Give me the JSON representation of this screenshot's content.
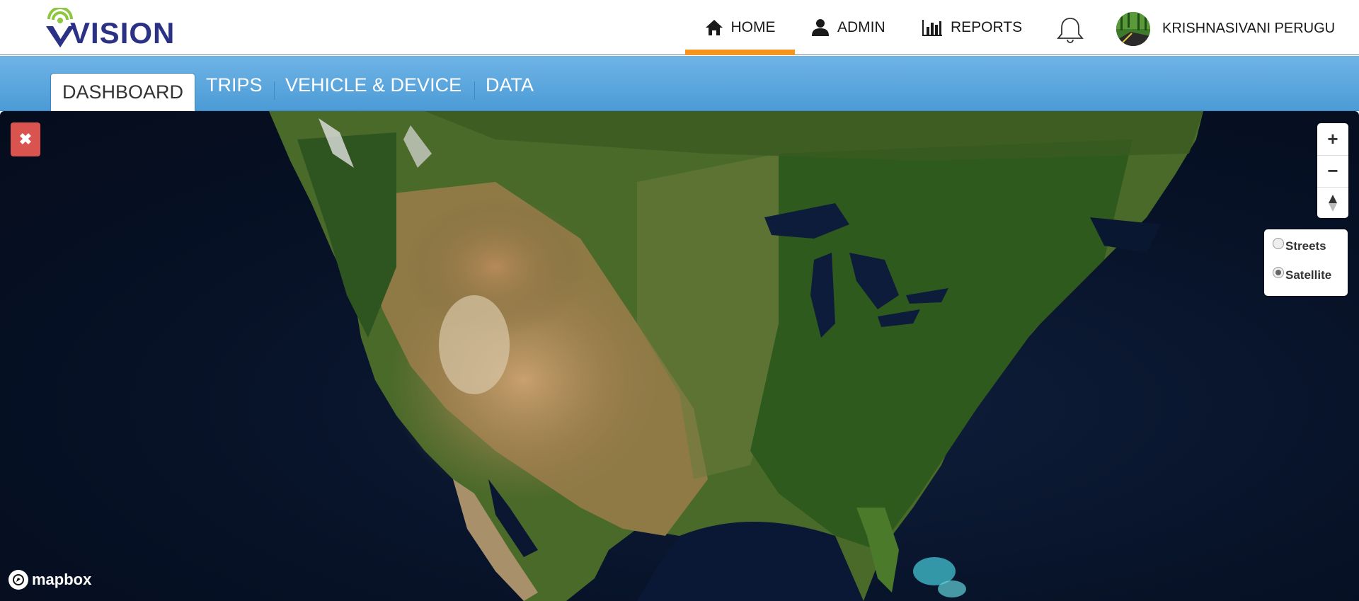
{
  "header": {
    "logo_text": "VISION",
    "nav": [
      {
        "label": "HOME",
        "icon": "home-icon",
        "active": true
      },
      {
        "label": "ADMIN",
        "icon": "user-icon",
        "active": false
      },
      {
        "label": "REPORTS",
        "icon": "bar-chart-icon",
        "active": false
      }
    ],
    "notifications_icon": "bell-icon",
    "user_name": "KRISHNASIVANI PERUGU"
  },
  "subnav": {
    "tabs": [
      {
        "label": "DASHBOARD",
        "active": true
      },
      {
        "label": "TRIPS",
        "active": false
      },
      {
        "label": "VEHICLE & DEVICE",
        "active": false
      },
      {
        "label": "DATA",
        "active": false
      }
    ]
  },
  "map": {
    "close_icon": "✖",
    "zoom_in": "+",
    "zoom_out": "−",
    "layers": [
      {
        "label": "Streets",
        "selected": false
      },
      {
        "label": "Satellite",
        "selected": true
      }
    ],
    "attribution": "mapbox"
  },
  "colors": {
    "brand_navy": "#2b3184",
    "brand_green": "#8dc63f",
    "active_tab_underline": "#f7941d",
    "subnav_blue": "#5aa6dd",
    "close_button": "#d9534f"
  }
}
